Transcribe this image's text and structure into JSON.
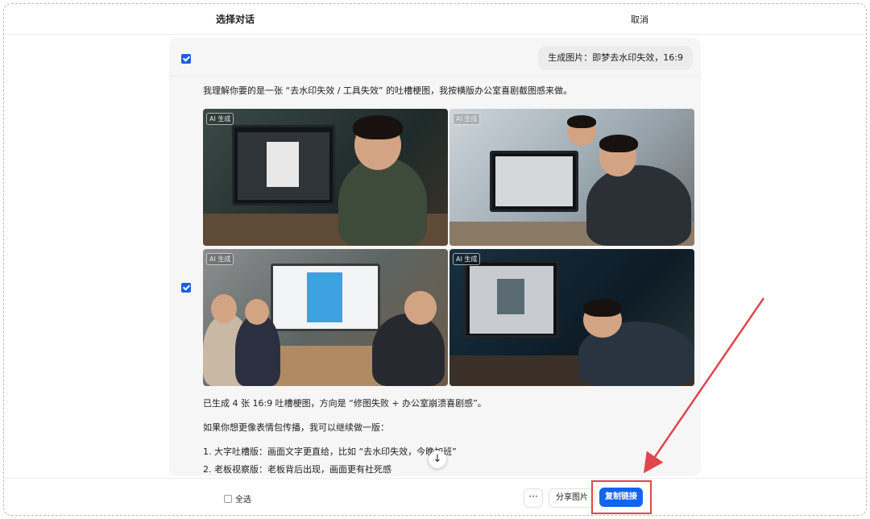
{
  "header": {
    "title": "选择对话",
    "cancel_label": "取消"
  },
  "conversation": {
    "user_message": "生成图片：即梦去水印失效，16:9",
    "assistant_intro": "我理解你要的是一张 “去水印失效 / 工具失效” 的吐槽梗图，我按横版办公室喜剧截图感来做。",
    "images": [
      {
        "tag": "AI 生成"
      },
      {
        "tag": "AI 生成"
      },
      {
        "tag": "AI 生成"
      },
      {
        "tag": "AI 生成"
      }
    ],
    "summary": "已生成 4 张 16:9 吐槽梗图，方向是 “修图失败 + 办公室崩溃喜剧感”。",
    "followup": "如果你想更像表情包传播，我可以继续做一版：",
    "options": [
      "1. 大字吐槽版：画面文字更直给，比如 “去水印失效，今晚加班”",
      "2. 老板视察版：老板背后出现，画面更有社死感"
    ]
  },
  "footer": {
    "select_all_label": "全选",
    "more_label": "···",
    "share_label": "分享图片",
    "copy_label": "复制链接"
  },
  "colors": {
    "accent": "#1464f0",
    "checkbox": "#1e5ce6",
    "annotation": "#e0464b"
  },
  "icons": {
    "scroll": "arrow-down-icon"
  }
}
